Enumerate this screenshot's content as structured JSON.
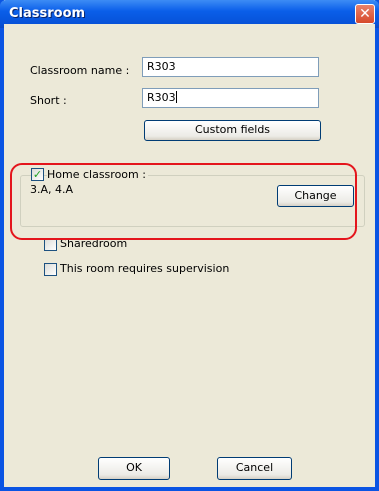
{
  "window": {
    "title": "Classroom",
    "close_glyph": "✕"
  },
  "form": {
    "name_label": "Classroom name :",
    "name_value": "R303",
    "short_label": "Short :",
    "short_value": "R303",
    "custom_fields_label": "Custom fields"
  },
  "home": {
    "label": "Home classroom :",
    "checked": true,
    "classes": "3.A, 4.A",
    "change_label": "Change"
  },
  "options": {
    "shared_label": "Sharedroom",
    "shared_checked": false,
    "supervision_label": "This room requires supervision",
    "supervision_checked": false
  },
  "footer": {
    "ok_label": "OK",
    "cancel_label": "Cancel"
  },
  "colors": {
    "titlebar": "#0a5ee9",
    "highlight": "#e4151c",
    "dialog_bg": "#ece9d8"
  }
}
